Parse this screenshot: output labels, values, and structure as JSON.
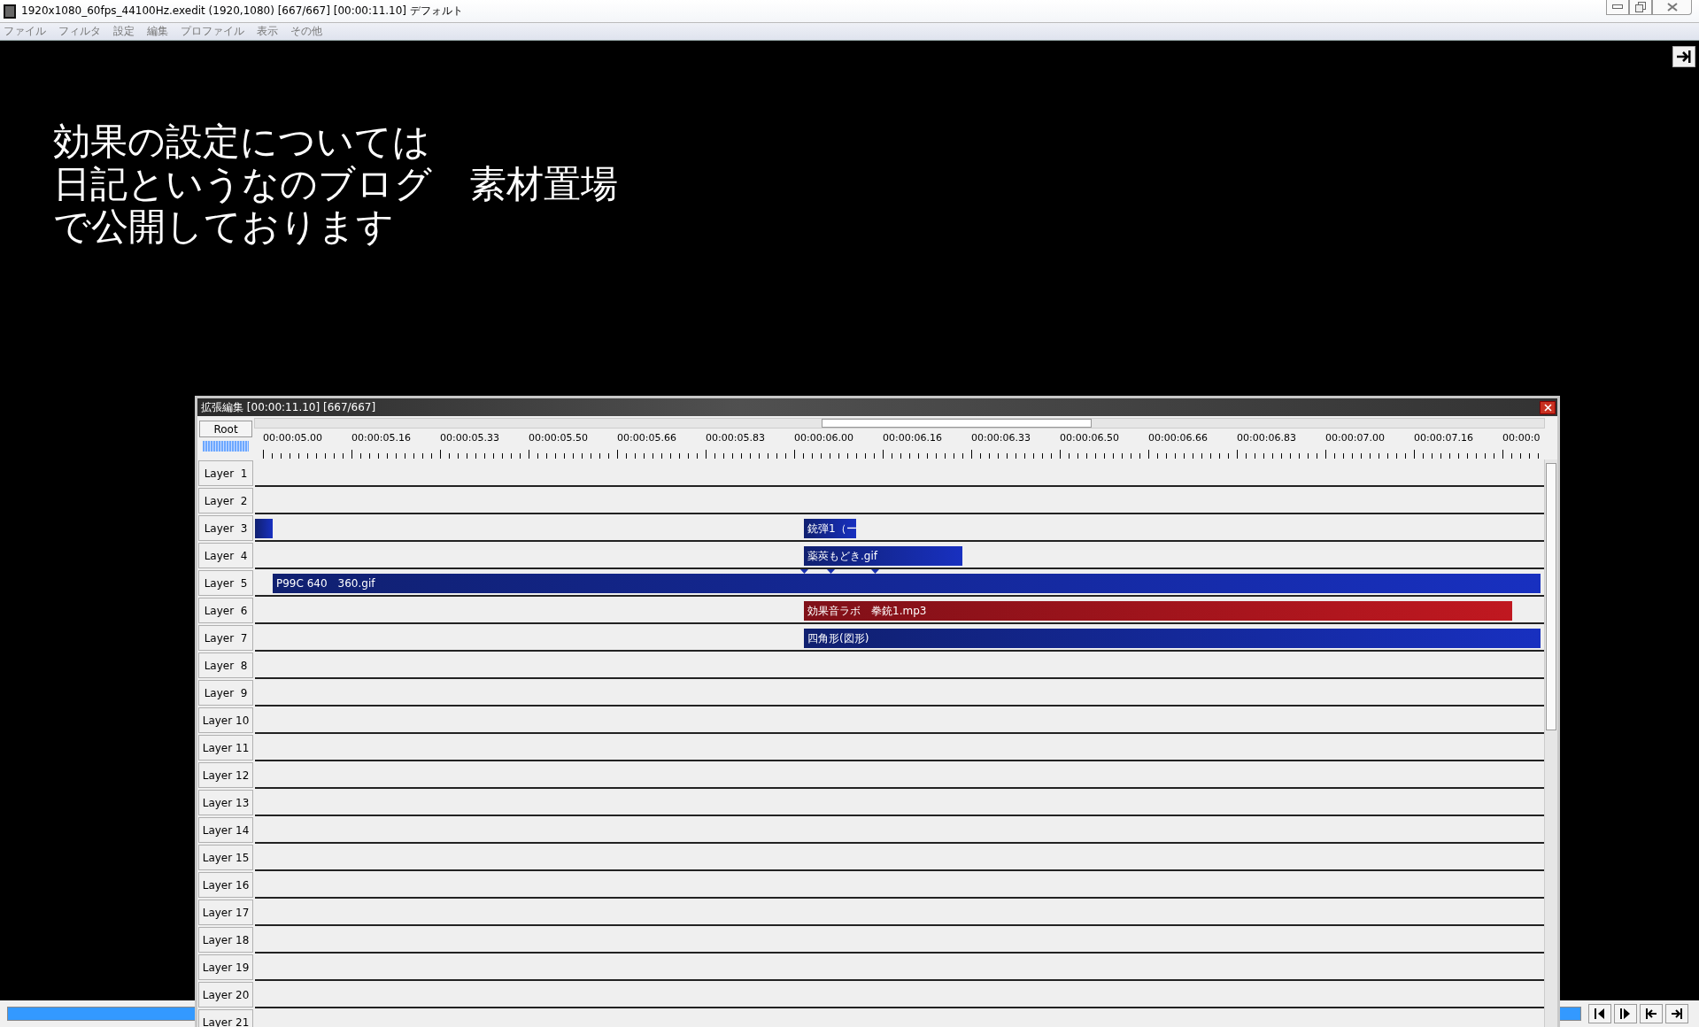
{
  "window": {
    "title": "1920x1080_60fps_44100Hz.exedit (1920,1080)  [667/667] [00:00:11.10]  デフォルト"
  },
  "menu": [
    "ファイル",
    "フィルタ",
    "設定",
    "編集",
    "プロファイル",
    "表示",
    "その他"
  ],
  "preview_text": [
    "効果の設定については",
    "日記というなのブログ　素材置場",
    "で公開しております"
  ],
  "seekbar": {
    "level": 1.0
  },
  "timeline": {
    "title": "拡張編集 [00:00:11.10] [667/667]",
    "root_button": "Root",
    "ruler": [
      "00:00:05.00",
      "00:00:05.16",
      "00:00:05.33",
      "00:00:05.50",
      "00:00:05.66",
      "00:00:05.83",
      "00:00:06.00",
      "00:00:06.16",
      "00:00:06.33",
      "00:00:06.50",
      "00:00:06.66",
      "00:00:06.83",
      "00:00:07.00",
      "00:00:07.16",
      "00:00:0"
    ],
    "layers": [
      {
        "label": "Layer  1"
      },
      {
        "label": "Layer  2"
      },
      {
        "label": "Layer  3",
        "clips": [
          {
            "kind": "object"
          },
          {
            "label": "銃弾1（ー",
            "kind": "object"
          }
        ]
      },
      {
        "label": "Layer  4",
        "clips": [
          {
            "label": "薬莢もどき.gif",
            "kind": "object"
          }
        ]
      },
      {
        "label": "Layer  5",
        "clips": [
          {
            "label": "P99C 640　360.gif",
            "kind": "object"
          }
        ]
      },
      {
        "label": "Layer  6",
        "clips": [
          {
            "label": "効果音ラボ　拳銃1.mp3",
            "kind": "audio"
          }
        ]
      },
      {
        "label": "Layer  7",
        "clips": [
          {
            "label": "四角形(図形)",
            "kind": "object"
          }
        ]
      },
      {
        "label": "Layer  8"
      },
      {
        "label": "Layer  9"
      },
      {
        "label": "Layer 10"
      },
      {
        "label": "Layer 11"
      },
      {
        "label": "Layer 12"
      },
      {
        "label": "Layer 13"
      },
      {
        "label": "Layer 14"
      },
      {
        "label": "Layer 15"
      },
      {
        "label": "Layer 16"
      },
      {
        "label": "Layer 17"
      },
      {
        "label": "Layer 18"
      },
      {
        "label": "Layer 19"
      },
      {
        "label": "Layer 20"
      },
      {
        "label": "Layer 21"
      }
    ]
  }
}
